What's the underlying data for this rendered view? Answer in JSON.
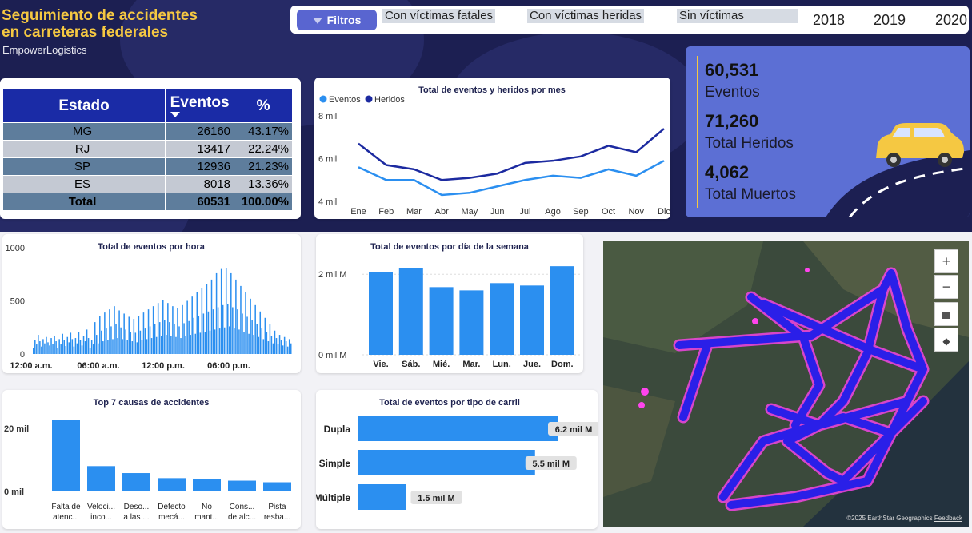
{
  "header": {
    "title_line1": "Seguimiento de accidentes",
    "title_line2": "en carreteras federales",
    "brand": "EmpowerLogistics"
  },
  "slicer": {
    "filter_label": "Filtros",
    "chips": [
      "Con víctimas fatales",
      "Con víctimas heridas",
      "Sin víctimas"
    ],
    "years": [
      "2018",
      "2019",
      "2020"
    ]
  },
  "state_table": {
    "headers": [
      "Estado",
      "Eventos",
      "%"
    ],
    "rows": [
      [
        "MG",
        "26160",
        "43.17%"
      ],
      [
        "RJ",
        "13417",
        "22.24%"
      ],
      [
        "SP",
        "12936",
        "21.23%"
      ],
      [
        "ES",
        "8018",
        "13.36%"
      ]
    ],
    "total": [
      "Total",
      "60531",
      "100.00%"
    ]
  },
  "kpis": {
    "events_value": "60,531",
    "events_label": "Eventos",
    "injured_value": "71,260",
    "injured_label": "Total Heridos",
    "deaths_value": "4,062",
    "deaths_label": "Total Muertos"
  },
  "colors": {
    "light_blue": "#2b8ff0",
    "dark_blue": "#1c2aa0",
    "header_navy": "#1c1f52",
    "title_gold": "#f5c842"
  },
  "chart_data": [
    {
      "id": "monthly",
      "type": "line",
      "title": "Total de eventos y heridos por mes",
      "categories": [
        "Ene",
        "Feb",
        "Mar",
        "Abr",
        "May",
        "Jun",
        "Jul",
        "Ago",
        "Sep",
        "Oct",
        "Nov",
        "Dic"
      ],
      "series": [
        {
          "name": "Eventos",
          "color": "#2b8ff0",
          "values": [
            5.6,
            5.0,
            5.0,
            4.3,
            4.4,
            4.7,
            5.0,
            5.2,
            5.1,
            5.5,
            5.2,
            5.9
          ]
        },
        {
          "name": "Heridos",
          "color": "#1c2aa0",
          "values": [
            6.7,
            5.7,
            5.5,
            5.0,
            5.1,
            5.3,
            5.8,
            5.9,
            6.1,
            6.6,
            6.3,
            7.4
          ]
        }
      ],
      "ytick_labels": [
        "8 mil",
        "6 mil",
        "4 mil"
      ],
      "ylim": [
        4,
        8
      ],
      "legend": "top-left"
    },
    {
      "id": "hourly",
      "type": "bar",
      "title": "Total de eventos por hora",
      "xtick_labels": [
        "12:00 a.m.",
        "06:00 a.m.",
        "12:00 p.m.",
        "06:00 p.m."
      ],
      "ytick_labels": [
        "1000",
        "500",
        "0"
      ],
      "ylim": [
        0,
        1000
      ],
      "values": [
        60,
        130,
        90,
        180,
        120,
        70,
        140,
        100,
        160,
        110,
        80,
        150,
        95,
        170,
        120,
        60,
        140,
        90,
        190,
        130,
        75,
        160,
        110,
        200,
        140,
        70,
        150,
        100,
        210,
        130,
        80,
        170,
        120,
        230,
        150,
        60,
        130,
        90,
        300,
        180,
        100,
        360,
        220,
        120,
        390,
        240,
        130,
        420,
        260,
        140,
        450,
        280,
        150,
        410,
        250,
        140,
        380,
        230,
        130,
        350,
        210,
        120,
        330,
        200,
        110,
        360,
        220,
        130,
        390,
        240,
        140,
        420,
        260,
        150,
        450,
        280,
        160,
        480,
        300,
        170,
        510,
        320,
        180,
        480,
        300,
        170,
        450,
        280,
        160,
        430,
        260,
        150,
        460,
        290,
        170,
        500,
        310,
        180,
        540,
        340,
        190,
        580,
        360,
        200,
        620,
        380,
        210,
        660,
        400,
        220,
        700,
        420,
        230,
        760,
        440,
        240,
        800,
        460,
        250,
        810,
        470,
        260,
        760,
        440,
        240,
        700,
        420,
        230,
        640,
        380,
        210,
        580,
        350,
        190,
        520,
        320,
        180,
        460,
        280,
        160,
        400,
        240,
        140,
        340,
        210,
        120,
        280,
        170,
        100,
        220,
        150,
        90,
        180,
        130,
        80,
        160,
        120,
        70,
        140,
        100
      ]
    },
    {
      "id": "weekday",
      "type": "bar",
      "title": "Total de eventos por día de la semana",
      "categories": [
        "Vie.",
        "Sáb.",
        "Mié.",
        "Mar.",
        "Lun.",
        "Jue.",
        "Dom."
      ],
      "values": [
        2.05,
        2.15,
        1.68,
        1.6,
        1.78,
        1.72,
        2.2
      ],
      "ytick_labels": [
        "2 mil M",
        "0 mil M"
      ],
      "ylim": [
        0,
        2.6
      ]
    },
    {
      "id": "causes",
      "type": "bar",
      "title": "Top 7 causas de accidentes",
      "categories": [
        [
          "Falta de",
          "atenc..."
        ],
        [
          "Veloci...",
          "inco..."
        ],
        [
          "Deso...",
          "a las ..."
        ],
        [
          "Defecto",
          "mecá..."
        ],
        [
          "No",
          "mant..."
        ],
        [
          "Cons...",
          "de alc..."
        ],
        [
          "Pista",
          "resba..."
        ]
      ],
      "values": [
        22.5,
        8,
        5.8,
        4.2,
        3.8,
        3.4,
        2.9
      ],
      "ytick_labels": [
        "20 mil",
        "0 mil"
      ],
      "ylim": [
        0,
        25
      ]
    },
    {
      "id": "lane",
      "type": "bar",
      "orientation": "horizontal",
      "title": "Total de eventos por tipo de carril",
      "categories": [
        "Dupla",
        "Simple",
        "Múltiple"
      ],
      "values": [
        6.2,
        5.5,
        1.5
      ],
      "data_labels": [
        "6.2 mil M",
        "5.5 mil M",
        "1.5 mil M"
      ],
      "xlim": [
        0,
        6.2
      ]
    }
  ],
  "map": {
    "attribution": "©2025 EarthStar Geographics",
    "feedback": "Feedback",
    "controls": [
      "+",
      "−"
    ]
  }
}
